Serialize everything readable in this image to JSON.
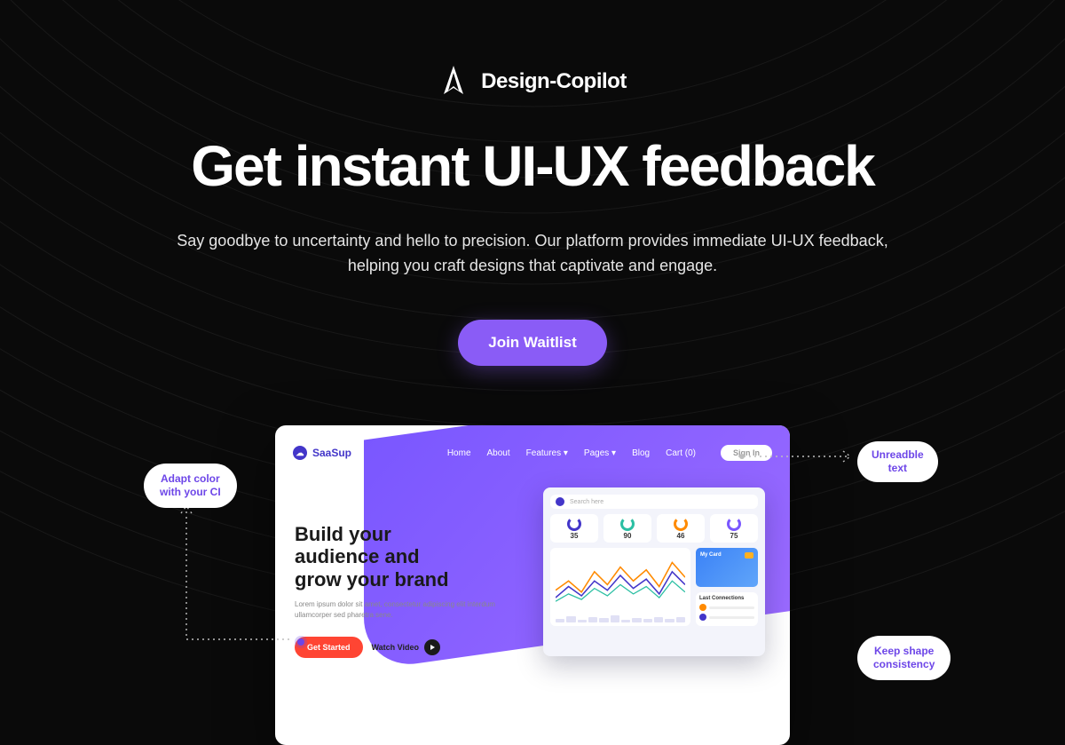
{
  "brand": {
    "name": "Design-Copilot"
  },
  "hero": {
    "headline": "Get instant UI-UX feedback",
    "subhead": "Say goodbye to uncertainty and hello to precision. Our platform provides immediate UI-UX feedback, helping you craft designs that captivate and engage.",
    "cta_label": "Join Waitlist"
  },
  "callouts": {
    "left": "Adapt color\nwith your CI",
    "right_top": "Unreadble\ntext",
    "right_bottom": "Keep shape\nconsistency"
  },
  "mock": {
    "brand": "SaaSup",
    "nav": {
      "home": "Home",
      "about": "About",
      "features": "Features ▾",
      "pages": "Pages ▾",
      "blog": "Blog",
      "cart": "Cart (0)"
    },
    "signin": "Sign In",
    "title": "Build your\naudience and\ngrow your brand",
    "lorem": "Lorem ipsum dolor sit amet, consectetur adipiscing elit interdum ullamcorper sed pharetra sene.",
    "get_started": "Get Started",
    "watch_video": "Watch Video",
    "search_placeholder": "Search here",
    "gauges": {
      "g1": "35",
      "g2": "90",
      "g3": "46",
      "g4": "75"
    },
    "card_label": "My Card",
    "last_label": "Last Connections"
  }
}
